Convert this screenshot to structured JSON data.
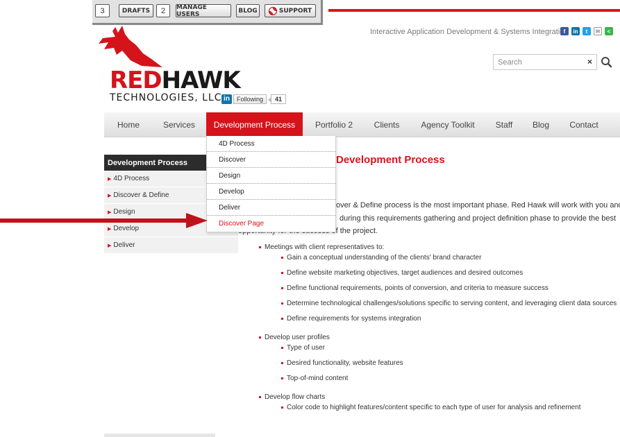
{
  "admin_bar": {
    "count_left": "3",
    "drafts": "DRAFTS",
    "drafts_count": "2",
    "manage_users": "MANAGE USERS",
    "blog": "BLOG",
    "support": "SUPPORT"
  },
  "header": {
    "tagline": "Interactive Application Development & Systems Integration",
    "social_icons": [
      "facebook-icon",
      "linkedin-icon",
      "twitter-icon",
      "email-icon",
      "share-icon"
    ],
    "search_placeholder": "Search",
    "search_clear": "×",
    "logo_red": "RED",
    "logo_hawk": "HAWK",
    "logo_sub": "TECHNOLOGIES, LLC",
    "linkedin": {
      "logo": "in",
      "label": "Following",
      "count": "41"
    }
  },
  "nav": {
    "items": [
      "Home",
      "Services",
      "Development Process",
      "Portfolio 2",
      "Clients",
      "Agency Toolkit",
      "Staff",
      "Blog",
      "Contact"
    ],
    "active": "Development Process"
  },
  "dropdown": {
    "items": [
      "4D Process",
      "Discover",
      "Design",
      "Develop",
      "Deliver",
      "Discover Page"
    ]
  },
  "sidebar": {
    "heading": "Development Process",
    "items": [
      "4D Process",
      "Discover & Define",
      "Design",
      "Develop",
      "Deliver"
    ]
  },
  "content": {
    "heading": "Development Process",
    "intro_lines": [
      "over & Define process is the most important phase. Red Hawk will work with you and",
      "during this requirements gathering and project definition phase to provide the best",
      "opportunity for the success of the project."
    ],
    "groups": [
      {
        "label": "Meetings with client representatives to:",
        "items": [
          "Gain a conceptual understanding of the clients' brand character",
          "Define website marketing objectives, target audiences and desired outcomes",
          "Define functional requirements, points of conversion, and criteria to measure success",
          "Determine technological challenges/solutions specific to serving content, and leveraging client data sources",
          "Define requirements for systems integration"
        ]
      },
      {
        "label": "Develop user profiles",
        "items": [
          "Type of user",
          "Desired functionality, website features",
          "Top-of-mind content"
        ]
      },
      {
        "label": "Develop flow charts",
        "items": [
          "Color code to highlight features/content specific to each type of user for analysis and refinement"
        ]
      }
    ]
  },
  "colors": {
    "brand_red": "#d5131b",
    "nav_bg": "#e8e8e8",
    "sidebar_head": "#2c2c2c"
  }
}
